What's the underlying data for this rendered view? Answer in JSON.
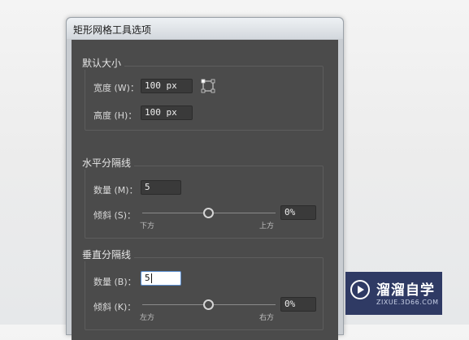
{
  "dialog": {
    "title": "矩形网格工具选项"
  },
  "default_size": {
    "group_label": "默认大小",
    "width_label": "宽度 (W)：",
    "width_value": "100 px",
    "height_label": "高度 (H)：",
    "height_value": "100 px",
    "reference_point_icon": "reference-point-icon"
  },
  "horizontal_dividers": {
    "group_label": "水平分隔线",
    "count_label": "数量 (M)：",
    "count_value": "5",
    "skew_label": "倾斜 (S)：",
    "skew_value": "0%",
    "skew_level": 0,
    "left_tick": "下方",
    "right_tick": "上方"
  },
  "vertical_dividers": {
    "group_label": "垂直分隔线",
    "count_label": "数量 (B)：",
    "count_value": "5",
    "skew_label": "倾斜 (K)：",
    "skew_value": "0%",
    "skew_level": 0,
    "left_tick": "左方",
    "right_tick": "右方"
  },
  "watermark": {
    "text": "溜溜自学",
    "sub": "ZIXUE.3D66.COM",
    "icon": "play-circle-icon"
  }
}
